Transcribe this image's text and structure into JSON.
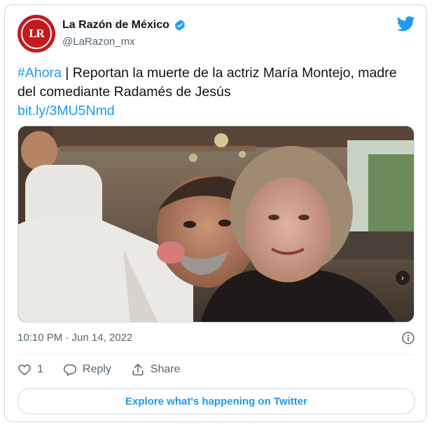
{
  "account": {
    "avatar_text": "LR",
    "name": "La Razón de México",
    "handle": "@LaRazon_mx"
  },
  "tweet": {
    "hashtag": "#Ahora",
    "text": " | Reportan la muerte de la actriz María Montejo, madre del comediante Radamés de Jesús",
    "link": "bit.ly/3MU5Nmd"
  },
  "meta": {
    "timestamp": "10:10 PM · Jun 14, 2022"
  },
  "actions": {
    "like_count": "1",
    "reply_label": "Reply",
    "share_label": "Share"
  },
  "footer": {
    "explore_label": "Explore what's happening on Twitter"
  },
  "colors": {
    "accent": "#1d9bf0",
    "brand_red": "#c41a1f",
    "muted": "#536471"
  },
  "icons": [
    "verified-badge-icon",
    "twitter-bird-icon",
    "info-icon",
    "heart-icon",
    "reply-icon",
    "share-icon",
    "chevron-right-icon"
  ]
}
